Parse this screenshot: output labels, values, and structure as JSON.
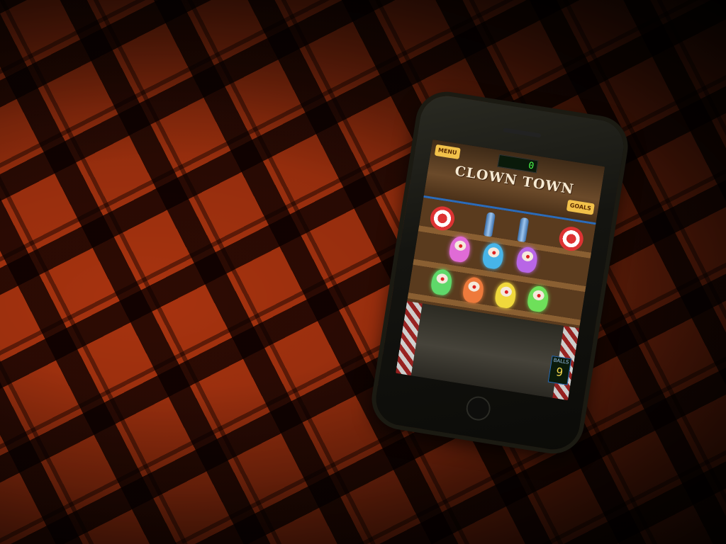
{
  "scene": {
    "surface": "red plaid tablecloth",
    "colors": {
      "red": "#a8330f",
      "dark": "#1a0603"
    }
  },
  "phone": {
    "icons": {
      "home": "home-button-icon",
      "speaker": "speaker-grille-icon"
    }
  },
  "game": {
    "menu_label": "MENU",
    "goals_label": "GOALS",
    "score": "0",
    "title": "CLOWN TOWN",
    "balls_label": "BALLS",
    "balls_count": "9",
    "clown_colors": [
      "#e06bd6",
      "#47b4e8",
      "#b866e6",
      "#5fd86a",
      "#ee7a3c",
      "#f0d83c",
      "#6ee05a"
    ]
  }
}
